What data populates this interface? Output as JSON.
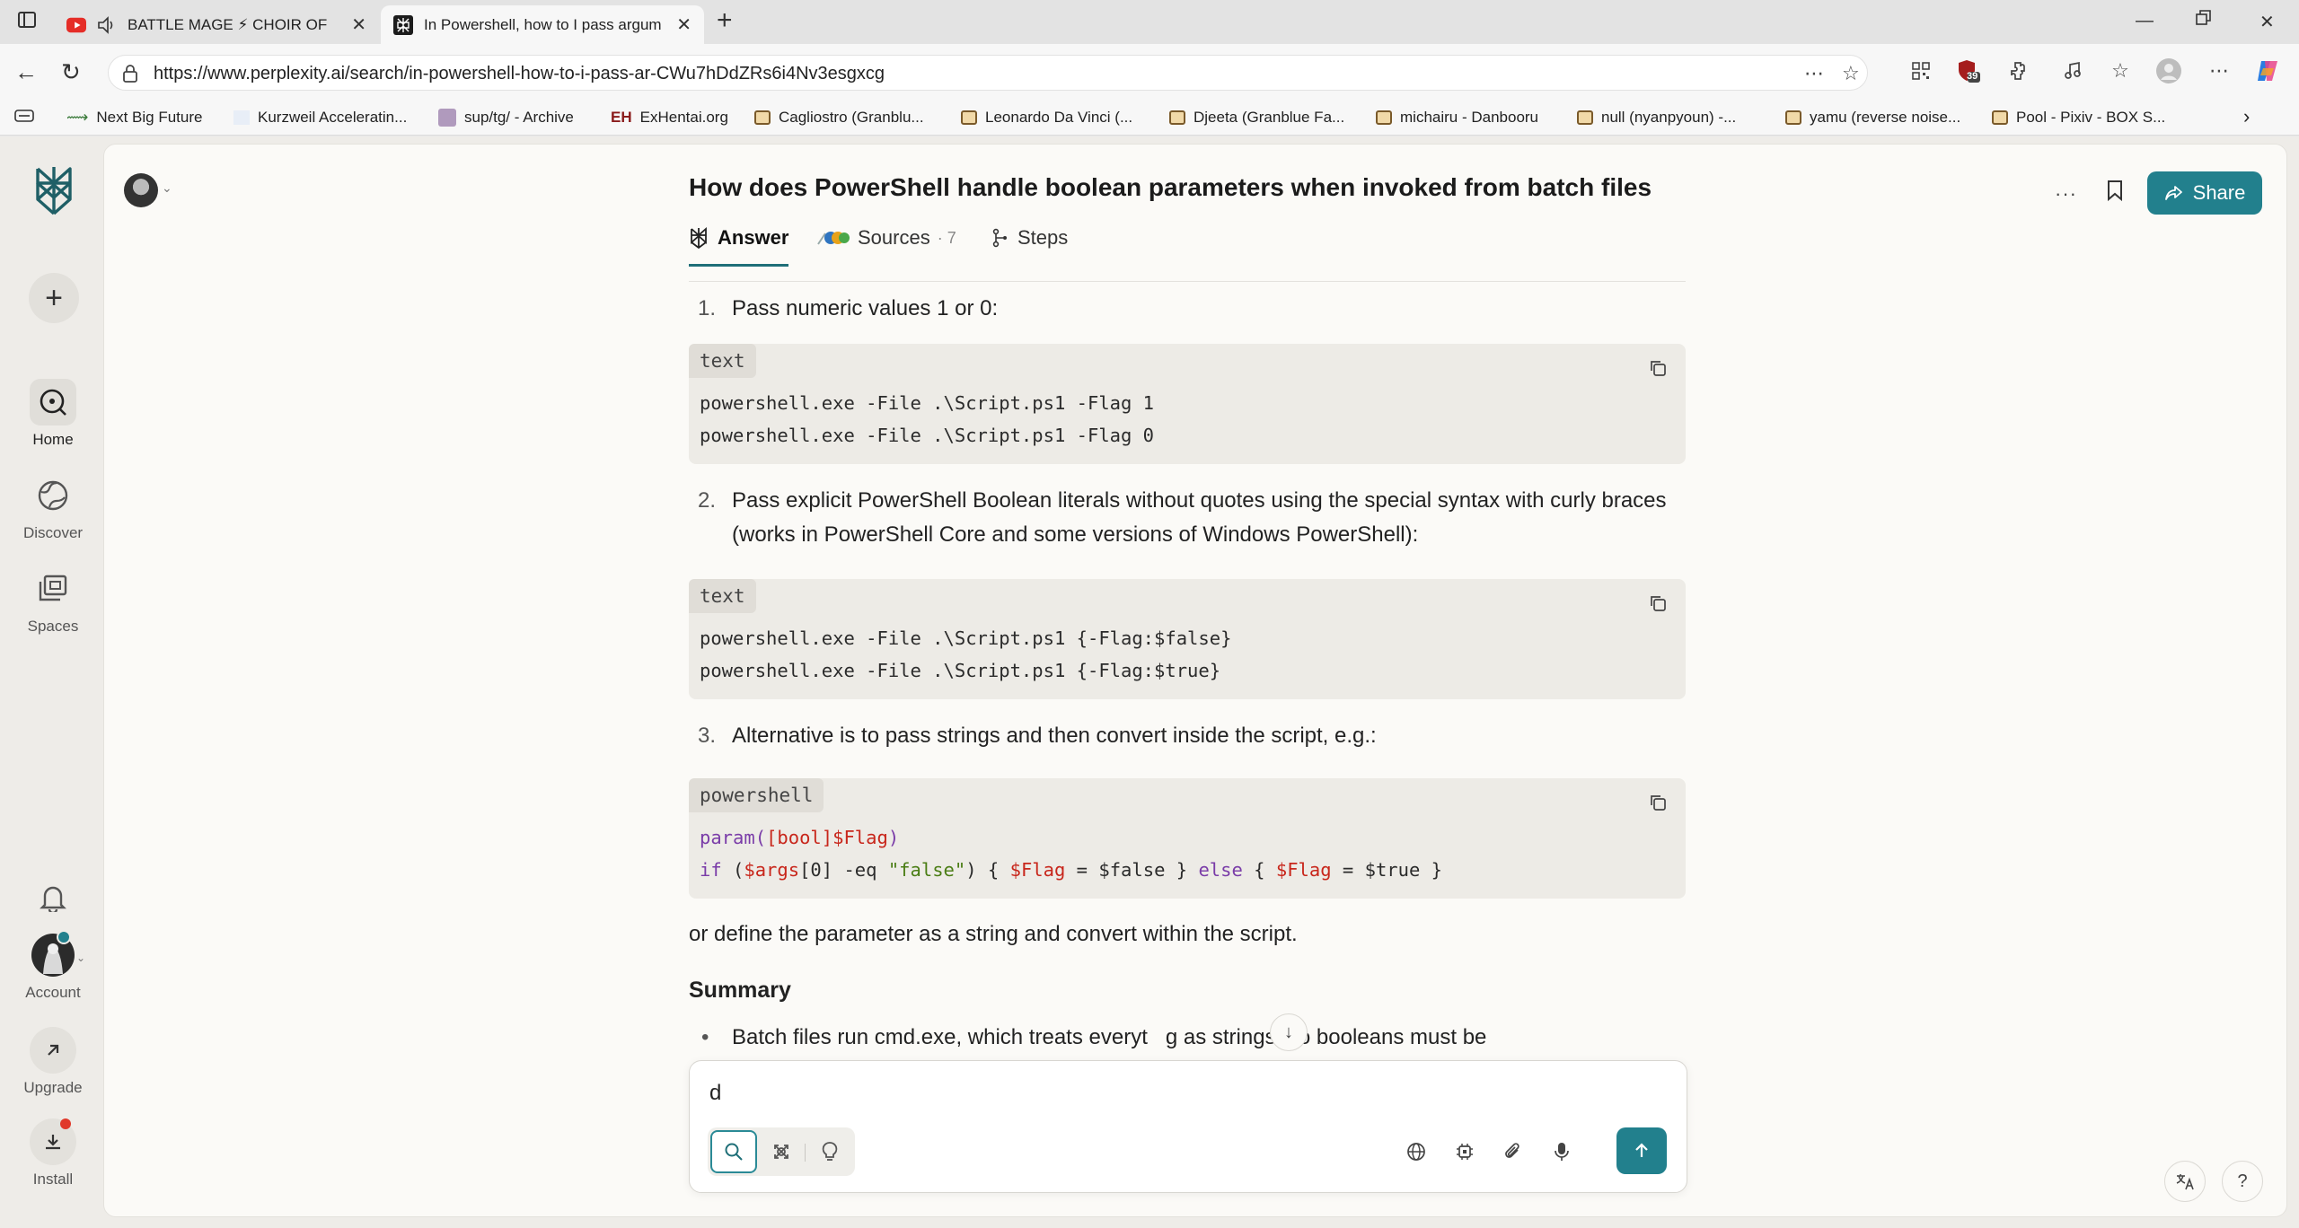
{
  "browser": {
    "tabs": [
      {
        "title": "BATTLE MAGE ⚡ CHOIR OF",
        "icon": "youtube-icon",
        "audio": true
      },
      {
        "title": "In Powershell, how to I pass argum",
        "icon": "perplexity-icon",
        "active": true
      }
    ],
    "url": "https://www.perplexity.ai/search/in-powershell-how-to-i-pass-ar-CWu7hDdZRs6i4Nv3esgxcg",
    "extension_badge": "39",
    "bookmarks": [
      "Next Big Future",
      "Kurzweil Acceleratin...",
      "sup/tg/ - Archive",
      "ExHentai.org",
      "Cagliostro (Granblu...",
      "Leonardo Da Vinci (...",
      "Djeeta (Granblue Fa...",
      "michairu - Danbooru",
      "null (nyanpyoun) -...",
      "yamu (reverse noise...",
      "Pool - Pixiv - BOX S..."
    ]
  },
  "sidebar": {
    "items": [
      {
        "label": "Home",
        "icon": "home-search-icon"
      },
      {
        "label": "Discover",
        "icon": "discover-icon"
      },
      {
        "label": "Spaces",
        "icon": "spaces-icon"
      }
    ],
    "bottom": [
      {
        "label": "Account"
      },
      {
        "label": "Upgrade"
      },
      {
        "label": "Install"
      }
    ]
  },
  "header": {
    "title": "How does PowerShell handle boolean parameters when invoked from batch files",
    "tabs": [
      {
        "label": "Answer"
      },
      {
        "label": "Sources",
        "count": "· 7"
      },
      {
        "label": "Steps"
      }
    ],
    "share_label": "Share"
  },
  "answer": {
    "step1": {
      "num": "1.",
      "text": "Pass numeric values 1 or 0:"
    },
    "code1": {
      "lang": "text",
      "lines": [
        "powershell.exe -File .\\Script.ps1 -Flag 1",
        "powershell.exe -File .\\Script.ps1 -Flag 0"
      ]
    },
    "step2": {
      "num": "2.",
      "text": "Pass explicit PowerShell Boolean literals without quotes using the special syntax with curly braces (works in PowerShell Core and some versions of Windows PowerShell):"
    },
    "code2": {
      "lang": "text",
      "lines": [
        "powershell.exe -File .\\Script.ps1 {-Flag:$false}",
        "powershell.exe -File .\\Script.ps1 {-Flag:$true}"
      ]
    },
    "step3": {
      "num": "3.",
      "text": "Alternative is to pass strings and then convert inside the script, e.g.:"
    },
    "code3": {
      "lang": "powershell",
      "line1": {
        "kw": "param(",
        "type": "[bool]",
        "var": "$Flag",
        "end": ")"
      },
      "line2": {
        "kw_if": "if",
        "p1": " (",
        "var1": "$args",
        "p2": "[0] -eq ",
        "str": "\"false\"",
        "p3": ") { ",
        "var2": "$Flag",
        "p4": " = $false } ",
        "kw_else": "else",
        "p5": " { ",
        "var3": "$Flag",
        "p6": " = $true }"
      }
    },
    "after": "or define the parameter as a string and convert within the script.",
    "summary_heading": "Summary",
    "bullet1_a": "Batch files run cmd.exe, which treats everyt",
    "bullet1_b": "g as strings, so booleans must be"
  },
  "composer": {
    "value": "d"
  }
}
